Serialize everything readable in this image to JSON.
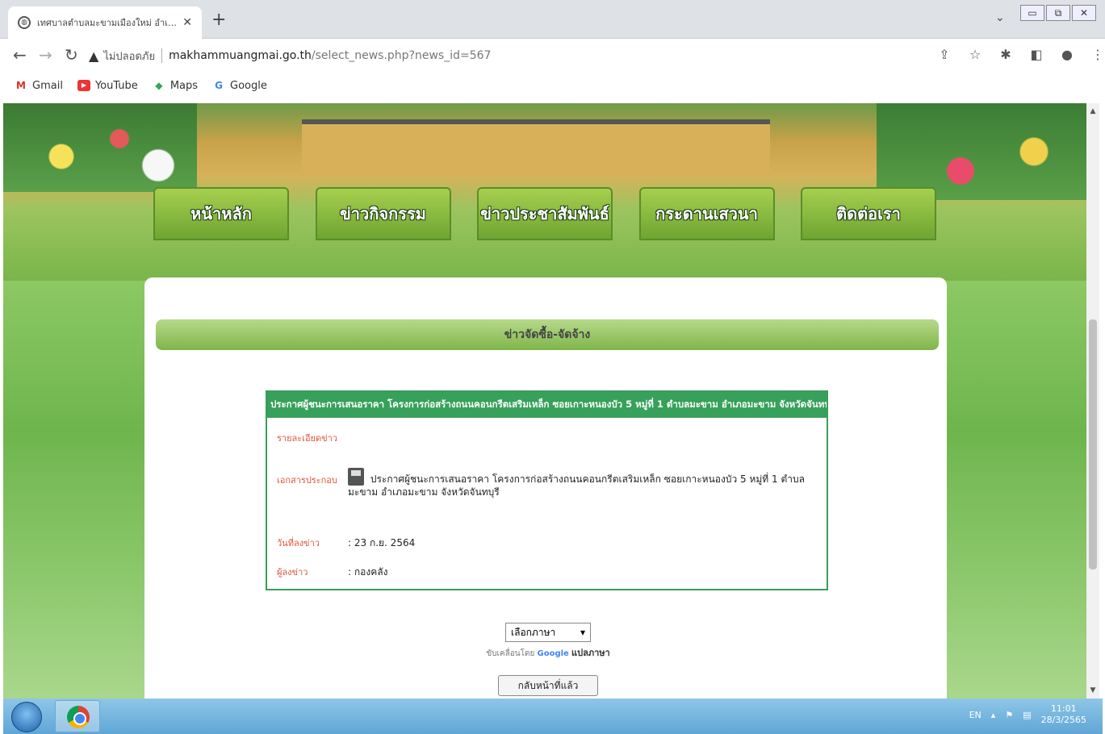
{
  "browser": {
    "tab_title": "เทศบาลตำบลมะขามเมืองใหม่ อำเภอมะ",
    "url_insecure_label": "ไม่ปลอดภัย",
    "url_host": "makhammuangmai.go.th",
    "url_path": "/select_news.php?news_id=567"
  },
  "bookmarks": [
    {
      "label": "Gmail",
      "icon": "gmail-icon"
    },
    {
      "label": "YouTube",
      "icon": "youtube-icon"
    },
    {
      "label": "Maps",
      "icon": "maps-icon"
    },
    {
      "label": "Google",
      "icon": "google-icon"
    }
  ],
  "nav": {
    "items": [
      "หน้าหลัก",
      "ข่าวกิจกรรม",
      "ข่าวประชาสัมพันธ์",
      "กระดานเสวนา",
      "ติดต่อเรา"
    ]
  },
  "page": {
    "section_title": "ข่าวจัดซื้อ-จัดจ้าง",
    "news_title": "ประกาศผู้ชนะการเสนอราคา โครงการก่อสร้างถนนคอนกรีตเสริมเหล็ก ซอยเกาะหนองบัว 5 หมู่ที่ 1 ตำบลมะขาม อำเภอมะขาม จังหวัดจันทบุรี",
    "detail_label": "รายละเอียดข่าว",
    "attachment_label": "เอกสารประกอบ",
    "attachment_text": "ประกาศผู้ชนะการเสนอราคา โครงการก่อสร้างถนนคอนกรีตเสริมเหล็ก ซอยเกาะหนองบัว 5 หมู่ที่ 1 ตำบลมะขาม อำเภอมะขาม จังหวัดจันทบุรี",
    "date_label": "วันที่ลงข่าว",
    "date_value": ": 23 ก.ย. 2564",
    "poster_label": "ผู้ลงข่าว",
    "poster_value": ": กองคลัง",
    "language_select": "เลือกภาษา",
    "powered_prefix": "ขับเคลื่อนโดย",
    "powered_google": "Google",
    "powered_translate": "แปลภาษา",
    "back_button": "กลับหน้าที่แล้ว"
  },
  "taskbar": {
    "lang": "EN",
    "time": "11:01",
    "date": "28/3/2565"
  }
}
